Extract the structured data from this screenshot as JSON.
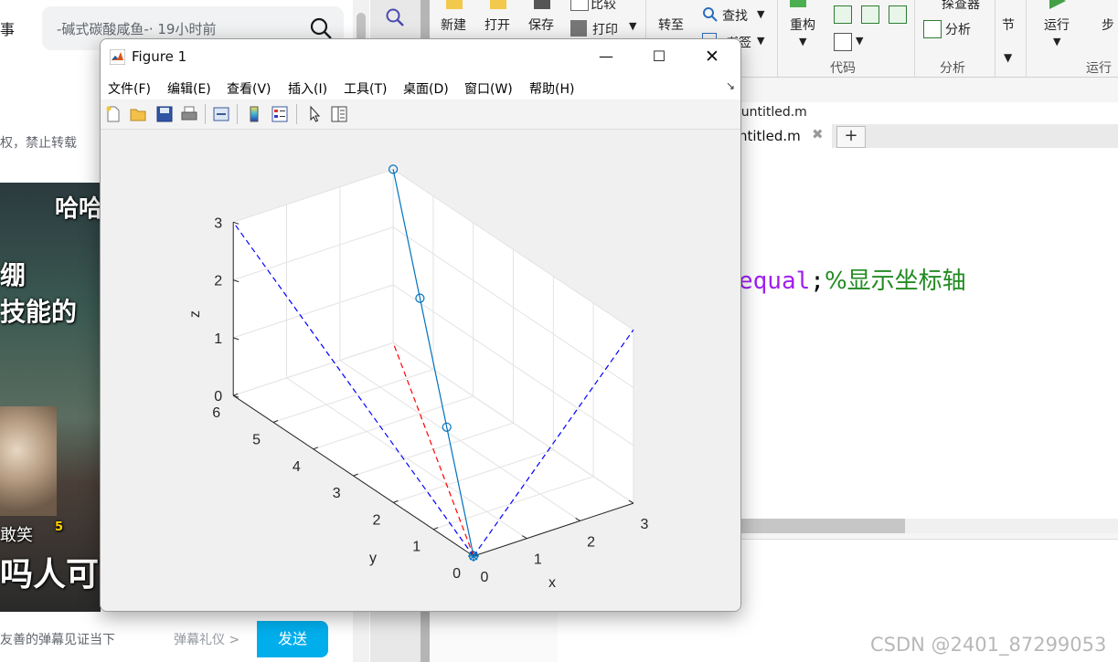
{
  "browser": {
    "search_text": "-碱式碳酸咸鱼-· 19小时前",
    "top_left_text": "事",
    "warn_text": "权，禁止转载",
    "video_texts": [
      "哈哈",
      "绷",
      "技能的",
      "敢笑",
      "5",
      "吗人可"
    ],
    "danmu_tip": "友善的弹幕见证当下",
    "danmu_gift": "弹幕礼仪 >",
    "send_label": "发送"
  },
  "matlab": {
    "toolbar_labels": {
      "new": "新建",
      "open": "打开",
      "save": "保存",
      "compare": "比较",
      "print": "打印",
      "goto": "转至",
      "find": "查找",
      "bookmark": "书签",
      "refactor": "重构",
      "profiler": "探查器",
      "analyze": "分析",
      "section": "节",
      "run": "运行",
      "step": "步"
    },
    "section_labels": {
      "code": "代码",
      "analysis": "分析",
      "run": "运行"
    },
    "path": "\\untitled.m",
    "tab_name": "ntitled.m",
    "code_keyword": "equal",
    "code_punct": ";",
    "code_comment": "%显示坐标轴",
    "watermark": "CSDN @2401_87299053",
    "colors": {
      "keyword": "#a020f0",
      "comment": "#228b22"
    }
  },
  "figure": {
    "title": "Figure 1",
    "menu": [
      "文件(F)",
      "编辑(E)",
      "查看(V)",
      "插入(I)",
      "工具(T)",
      "桌面(D)",
      "窗口(W)",
      "帮助(H)"
    ],
    "toolbar_icons": [
      "new-file-icon",
      "open-folder-icon",
      "save-icon",
      "print-icon",
      "link-icon",
      "colorbar-icon",
      "legend-icon",
      "pointer-icon",
      "property-editor-icon"
    ]
  },
  "chart_data": {
    "type": "line",
    "xlabel": "x",
    "ylabel": "y",
    "zlabel": "z",
    "xlim": [
      0,
      3
    ],
    "ylim": [
      0,
      6
    ],
    "zlim": [
      0,
      3
    ],
    "xticks": [
      0,
      1,
      2,
      3
    ],
    "yticks": [
      0,
      1,
      2,
      3,
      4,
      5,
      6
    ],
    "zticks": [
      0,
      1,
      2,
      3
    ],
    "grid": true,
    "series": [
      {
        "style": "solid-circles",
        "color": "#0072bd",
        "points": [
          [
            0,
            0,
            0
          ],
          [
            1,
            2,
            1
          ],
          [
            2,
            4,
            2
          ],
          [
            3,
            6,
            3
          ]
        ]
      },
      {
        "style": "dashed",
        "color": "#0000ff",
        "points": [
          [
            0,
            0,
            0
          ],
          [
            3,
            0,
            3
          ]
        ]
      },
      {
        "style": "dashed",
        "color": "#0000ff",
        "points": [
          [
            0,
            0,
            0
          ],
          [
            0,
            6,
            3
          ]
        ]
      },
      {
        "style": "dashed",
        "color": "#ff0000",
        "points": [
          [
            0,
            0,
            0
          ],
          [
            3,
            6,
            0
          ]
        ]
      }
    ]
  }
}
